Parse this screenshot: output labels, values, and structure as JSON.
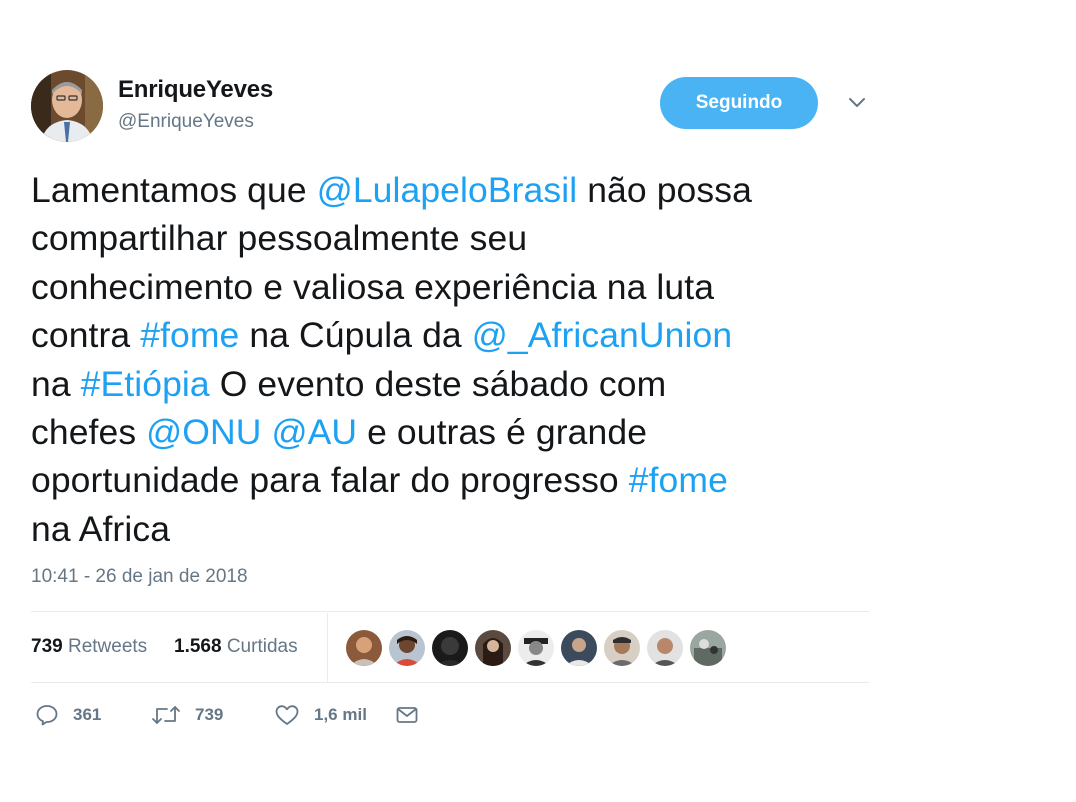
{
  "user": {
    "display_name": "EnriqueYeves",
    "handle": "@EnriqueYeves",
    "follow_label": "Seguindo"
  },
  "tweet": {
    "lines": [
      [
        {
          "t": "Lamentamos que ",
          "link": false
        },
        {
          "t": "@LulapeloBrasil",
          "link": true
        },
        {
          "t": " não possa",
          "link": false
        }
      ],
      [
        {
          "t": "compartilhar pessoalmente seu",
          "link": false
        }
      ],
      [
        {
          "t": "conhecimento e valiosa experiência na luta",
          "link": false
        }
      ],
      [
        {
          "t": "contra ",
          "link": false
        },
        {
          "t": "#fome",
          "link": true
        },
        {
          "t": " na Cúpula da ",
          "link": false
        },
        {
          "t": "@_AfricanUnion",
          "link": true
        }
      ],
      [
        {
          "t": "na ",
          "link": false
        },
        {
          "t": "#Etiópia",
          "link": true
        },
        {
          "t": " O evento deste sábado com",
          "link": false
        }
      ],
      [
        {
          "t": "chefes ",
          "link": false
        },
        {
          "t": "@ONU",
          "link": true
        },
        {
          "t": " ",
          "link": false
        },
        {
          "t": "@AU",
          "link": true
        },
        {
          "t": " e outras é grande",
          "link": false
        }
      ],
      [
        {
          "t": "oportunidade para falar do progresso ",
          "link": false
        },
        {
          "t": "#fome",
          "link": true
        }
      ],
      [
        {
          "t": "na Africa",
          "link": false
        }
      ]
    ],
    "timestamp": "10:41 - 26 de jan de 2018"
  },
  "stats": {
    "retweets_count": "739",
    "retweets_label": "Retweets",
    "likes_count": "1.568",
    "likes_label": "Curtidas"
  },
  "actions": {
    "reply_count": "361",
    "retweet_count": "739",
    "like_count": "1,6 mil"
  },
  "icons": [
    "chevron-down-icon",
    "reply-icon",
    "retweet-icon",
    "heart-icon",
    "message-icon"
  ],
  "colors": {
    "accent": "#1da1f2",
    "button": "#4ab3f4",
    "secondary_text": "#657786",
    "divider": "#e6ecf0"
  }
}
